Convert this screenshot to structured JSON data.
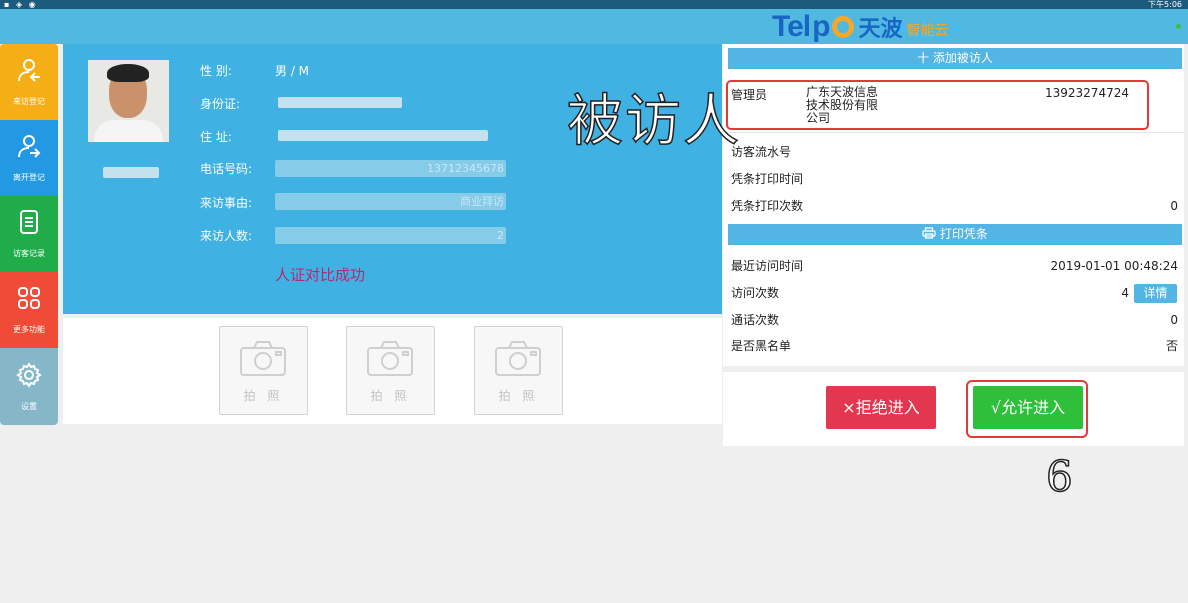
{
  "status_bar": {
    "time": "下午5:06"
  },
  "logo": {
    "brand": "Telpo",
    "cn_name": "天波",
    "sub": "智能云"
  },
  "colors": {
    "topbar": "#51b8e0",
    "profile_bg": "#3fb1e2",
    "reject": "#e3364f",
    "allow": "#2ebf3b",
    "annotation_box": "#e23a3a"
  },
  "sidebar": {
    "items": [
      {
        "label": "来访登记",
        "icon": "visitor-checkin-icon",
        "color": "#f6ae16"
      },
      {
        "label": "离开登记",
        "icon": "visitor-checkout-icon",
        "color": "#2399e3"
      },
      {
        "label": "访客记录",
        "icon": "document-list-icon",
        "color": "#20ac4a"
      },
      {
        "label": "更多功能",
        "icon": "grid-apps-icon",
        "color": "#f04b36"
      },
      {
        "label": "设置",
        "icon": "gear-icon",
        "color": "#85b7c9"
      }
    ]
  },
  "visitor": {
    "gender_label": "性 别:",
    "gender_value": "男 / M",
    "id_label": "身份证:",
    "address_label": "住 址:",
    "phone_label": "电话号码:",
    "phone_value": "13712345678",
    "reason_label": "来访事由:",
    "reason_value": "商业拜访",
    "count_label": "来访人数:",
    "count_value": "2",
    "verify_status": "人证对比成功"
  },
  "photos": [
    {
      "label": "拍 照"
    },
    {
      "label": "拍 照"
    },
    {
      "label": "拍 照"
    }
  ],
  "right_panel": {
    "add_visitee_label": "十 添加被访人",
    "visitee": {
      "role": "管理员",
      "company": "广东天波信息\n技术股份有限\n公司",
      "phone": "13923274724"
    },
    "serial_label": "访客流水号",
    "print_time_label": "凭条打印时间",
    "print_count_label": "凭条打印次数",
    "print_count_value": "0",
    "print_receipt_label": "打印凭条",
    "last_visit_label": "最近访问时间",
    "last_visit_value": "2019-01-01 00:48:24",
    "visit_count_label": "访问次数",
    "visit_count_value": "4",
    "details_label": "详情",
    "call_count_label": "通话次数",
    "call_count_value": "0",
    "blacklist_label": "是否黑名单",
    "blacklist_value": "否"
  },
  "actions": {
    "reject": "×拒绝进入",
    "allow": "√允许进入"
  },
  "annotations": {
    "visitee": "被访人",
    "step": "6"
  }
}
